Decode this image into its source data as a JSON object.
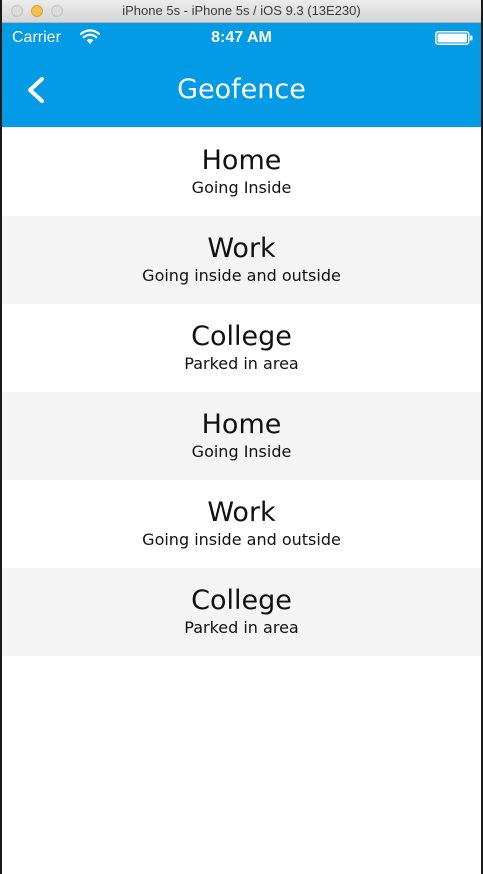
{
  "window": {
    "title": "iPhone 5s - iPhone 5s / iOS 9.3 (13E230)"
  },
  "status_bar": {
    "carrier": "Carrier",
    "time": "8:47 AM",
    "wifi_icon": "wifi-icon",
    "battery_icon": "battery-icon"
  },
  "nav": {
    "back_icon": "chevron-left-icon",
    "title": "Geofence"
  },
  "colors": {
    "accent": "#039be5",
    "row_alt": "#f4f4f4",
    "row": "#ffffff",
    "text": "#111111"
  },
  "geofences": [
    {
      "name": "Home",
      "event": "Going Inside"
    },
    {
      "name": "Work",
      "event": "Going inside and outside"
    },
    {
      "name": "College",
      "event": "Parked in area"
    },
    {
      "name": "Home",
      "event": "Going Inside"
    },
    {
      "name": "Work",
      "event": "Going inside and outside"
    },
    {
      "name": "College",
      "event": "Parked in area"
    }
  ]
}
